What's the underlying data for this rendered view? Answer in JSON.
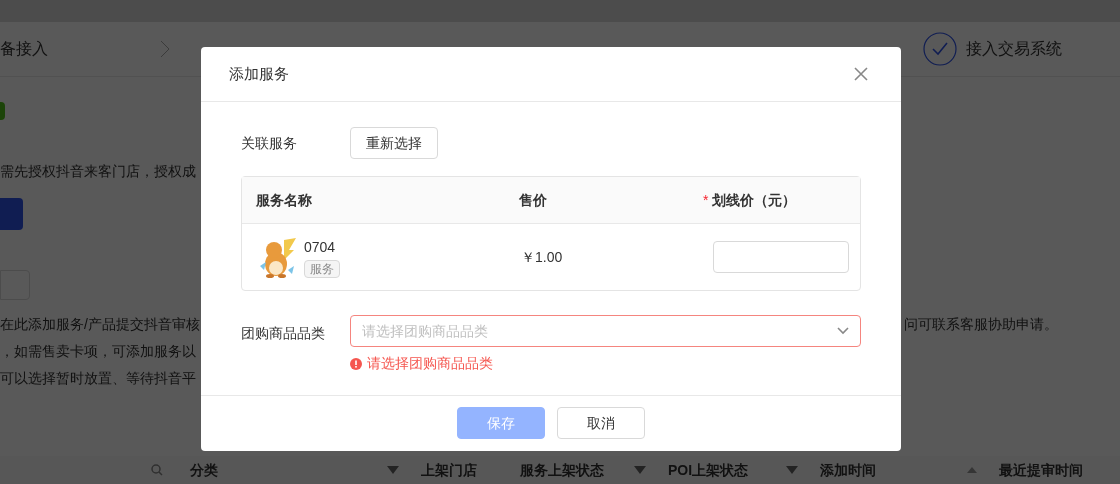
{
  "background": {
    "steps": [
      {
        "label": "备接入",
        "done": false
      },
      {
        "label": "接入交易系统",
        "done": true
      }
    ],
    "auth_text": "需先授权抖音来客门店，授权成",
    "notes": [
      {
        "left": "在此添加服务/产品提交抖音审核",
        "right": "问可联系客服协助申请。"
      },
      {
        "left": "，如需售卖卡项，可添加服务以"
      },
      {
        "left": "可以选择暂时放置、等待抖音平"
      }
    ],
    "table_columns": [
      {
        "label": "分类",
        "kind": "filter"
      },
      {
        "label": "上架门店",
        "kind": "plain"
      },
      {
        "label": "服务上架状态",
        "kind": "filter"
      },
      {
        "label": "POI上架状态",
        "kind": "filter"
      },
      {
        "label": "添加时间",
        "kind": "sort"
      },
      {
        "label": "最近提审时间",
        "kind": "plain"
      }
    ]
  },
  "modal": {
    "title": "添加服务",
    "related_label": "关联服务",
    "reselect_button": "重新选择",
    "table": {
      "columns": [
        {
          "label": "服务名称"
        },
        {
          "label": "售价"
        },
        {
          "label": "划线价（元）",
          "marker": "*"
        }
      ],
      "rows": [
        {
          "name": "0704",
          "tag": "服务",
          "price": "￥1.00"
        }
      ]
    },
    "category": {
      "label": "团购商品品类",
      "placeholder": "请选择团购商品品类",
      "error": "请选择团购商品品类"
    },
    "buttons": [
      {
        "label": "保存",
        "kind": "primary",
        "disabled": true
      },
      {
        "label": "取消",
        "kind": "default",
        "disabled": false
      }
    ]
  }
}
